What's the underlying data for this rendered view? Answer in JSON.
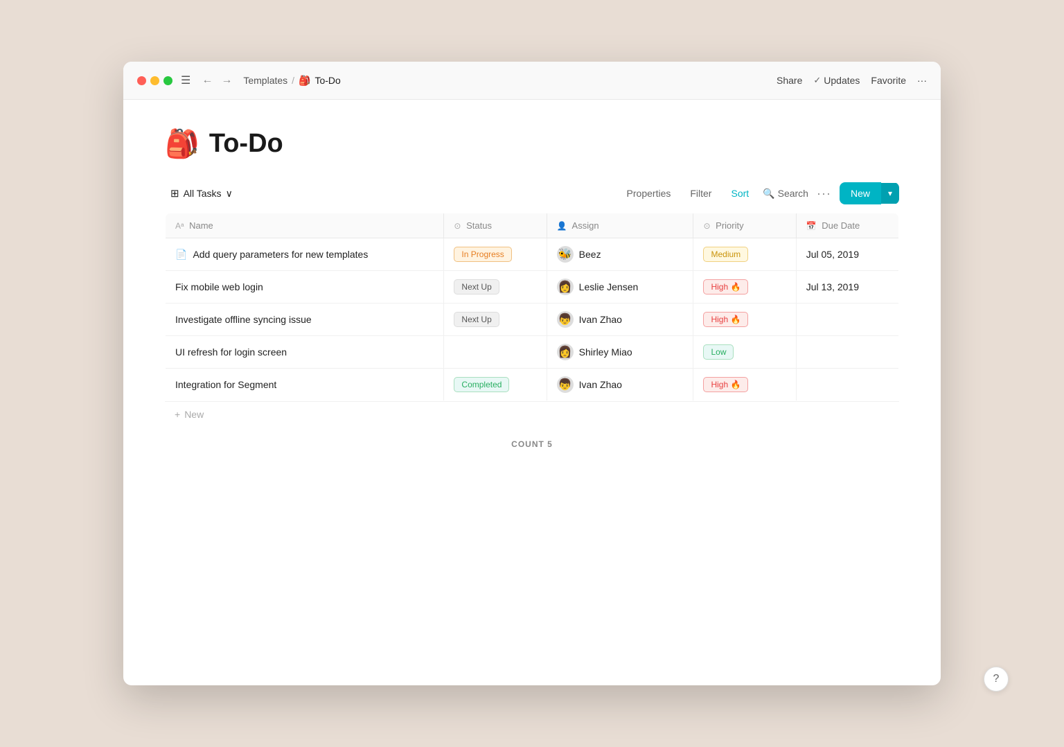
{
  "window": {
    "title": "To-Do"
  },
  "titlebar": {
    "breadcrumb_parent": "Templates",
    "breadcrumb_separator": "/",
    "breadcrumb_current": "To-Do",
    "page_icon": "🎒",
    "share_label": "Share",
    "updates_label": "Updates",
    "favorite_label": "Favorite",
    "more_label": "···"
  },
  "toolbar": {
    "all_tasks_label": "All Tasks",
    "properties_label": "Properties",
    "filter_label": "Filter",
    "sort_label": "Sort",
    "search_label": "Search",
    "new_label": "New"
  },
  "table": {
    "columns": [
      {
        "id": "name",
        "label": "Name",
        "icon": "Aa"
      },
      {
        "id": "status",
        "label": "Status",
        "icon": "⊙"
      },
      {
        "id": "assign",
        "label": "Assign",
        "icon": "👤"
      },
      {
        "id": "priority",
        "label": "Priority",
        "icon": "⊙"
      },
      {
        "id": "duedate",
        "label": "Due Date",
        "icon": "📅"
      }
    ],
    "rows": [
      {
        "id": 1,
        "name": "Add query parameters for new templates",
        "has_icon": true,
        "status": "In Progress",
        "status_type": "inprogress",
        "assign": "Beez",
        "assign_avatar": "🐝",
        "priority": "Medium",
        "priority_type": "medium",
        "priority_emoji": "",
        "duedate": "Jul 05, 2019"
      },
      {
        "id": 2,
        "name": "Fix mobile web login",
        "has_icon": false,
        "status": "Next Up",
        "status_type": "nextup",
        "assign": "Leslie Jensen",
        "assign_avatar": "👩",
        "priority": "High 🔥",
        "priority_type": "high",
        "priority_emoji": "🔥",
        "duedate": "Jul 13, 2019"
      },
      {
        "id": 3,
        "name": "Investigate offline syncing issue",
        "has_icon": false,
        "status": "Next Up",
        "status_type": "nextup",
        "assign": "Ivan Zhao",
        "assign_avatar": "👦",
        "priority": "High 🔥",
        "priority_type": "high",
        "priority_emoji": "🔥",
        "duedate": ""
      },
      {
        "id": 4,
        "name": "UI refresh for login screen",
        "has_icon": false,
        "status": "",
        "status_type": "none",
        "assign": "Shirley Miao",
        "assign_avatar": "👩",
        "priority": "Low",
        "priority_type": "low",
        "priority_emoji": "",
        "duedate": ""
      },
      {
        "id": 5,
        "name": "Integration for Segment",
        "has_icon": false,
        "status": "Completed",
        "status_type": "completed",
        "assign": "Ivan Zhao",
        "assign_avatar": "👦",
        "priority": "High 🔥",
        "priority_type": "high",
        "priority_emoji": "🔥",
        "duedate": ""
      }
    ],
    "add_new_label": "New",
    "count_label": "COUNT",
    "count_value": "5"
  },
  "help": {
    "label": "?"
  }
}
